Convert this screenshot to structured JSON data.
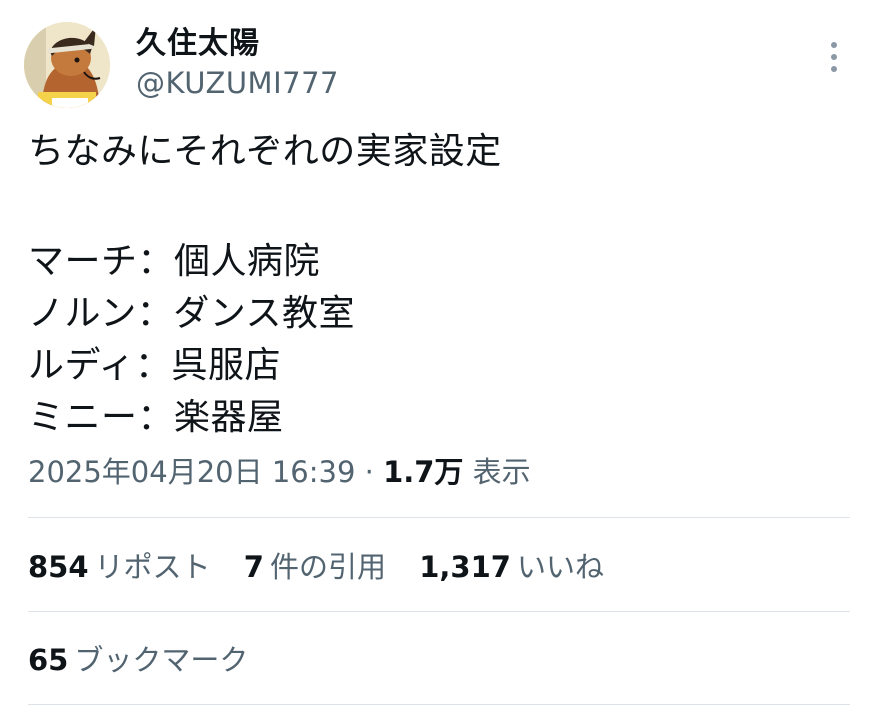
{
  "author": {
    "display_name": "久住太陽",
    "handle": "@KUZUMI777"
  },
  "tweet": {
    "lines": [
      "ちなみにそれぞれの実家設定",
      "マーチ：個人病院",
      "ノルン：ダンス教室",
      "ルディ：呉服店",
      "ミニー：楽器屋"
    ]
  },
  "meta": {
    "timestamp": "2025年04月20日 16:39",
    "separator": "·",
    "views_count": "1.7万",
    "views_label": "表示"
  },
  "stats": {
    "reposts_count": "854",
    "reposts_label": "リポスト",
    "quotes_count": "7",
    "quotes_label": "件の引用",
    "likes_count": "1,317",
    "likes_label": "いいね"
  },
  "bookmarks": {
    "count": "65",
    "label": "ブックマーク"
  },
  "colors": {
    "text": "#0f1419",
    "secondary": "#536471",
    "divider": "#dde3e8"
  },
  "icons": {
    "more": "more-vertical-icon"
  }
}
